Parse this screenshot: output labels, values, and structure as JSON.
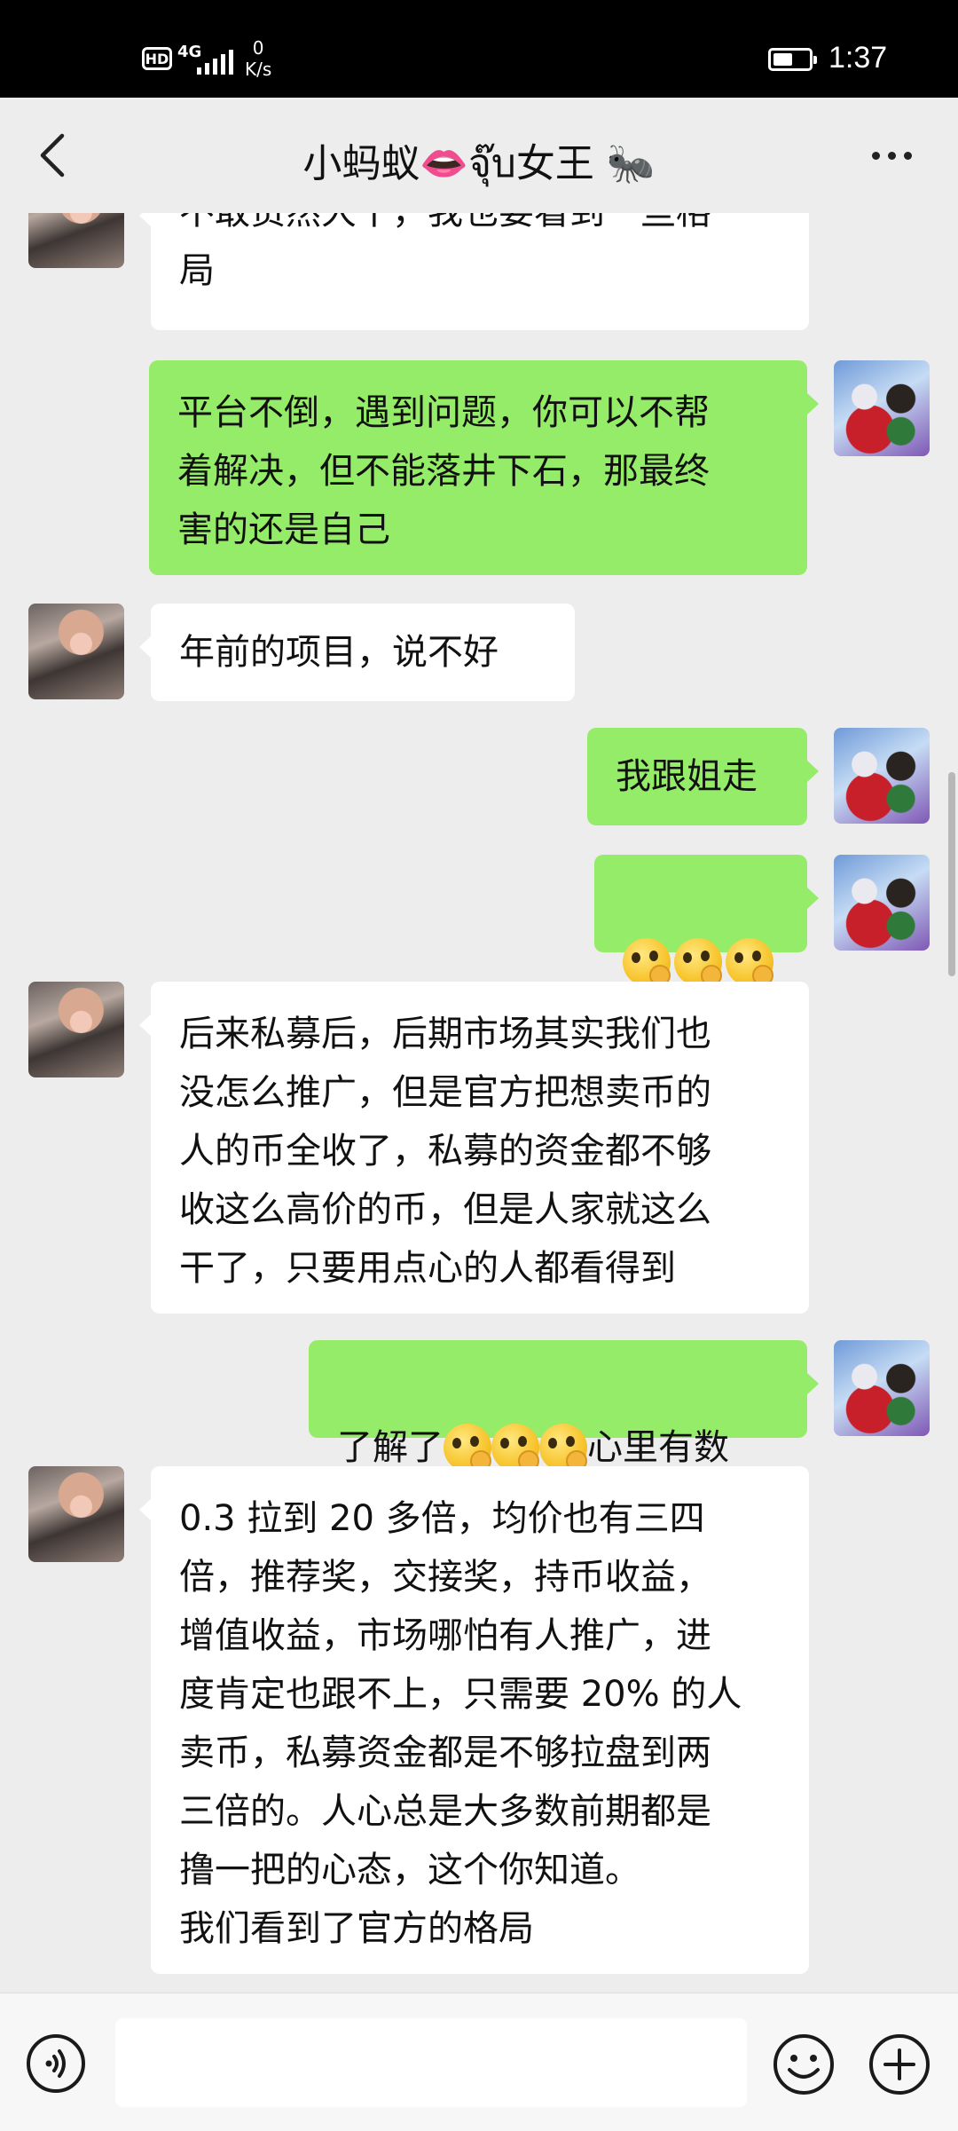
{
  "status_bar": {
    "hd": "HD",
    "network": "4G",
    "speed_value": "0",
    "speed_unit": "K/s",
    "time": "1:37",
    "battery_level": 0.55
  },
  "header": {
    "title": "小蚂蚁👄จุ๊บ女王 🐜",
    "back_icon": "chevron-left-icon",
    "more_icon": "more-dots-icon"
  },
  "messages": [
    {
      "side": "left",
      "text": "不敢贸然大干，我也要看到一些格\n局"
    },
    {
      "side": "right",
      "text": "平台不倒，遇到问题，你可以不帮\n着解决，但不能落井下石，那最终\n害的还是自己"
    },
    {
      "side": "left",
      "text": "年前的项目，说不好"
    },
    {
      "side": "right",
      "text": "我跟姐走"
    },
    {
      "side": "right",
      "emoji": [
        "salute-emoji",
        "salute-emoji",
        "salute-emoji"
      ]
    },
    {
      "side": "left",
      "text": "后来私募后，后期市场其实我们也\n没怎么推广，但是官方把想卖币的\n人的币全收了，私募的资金都不够\n收这么高价的币，但是人家就这么\n干了，只要用点心的人都看得到"
    },
    {
      "side": "right",
      "text_before": "了解了",
      "emoji": [
        "salute-emoji",
        "salute-emoji",
        "salute-emoji"
      ],
      "text_after": "心里有数"
    },
    {
      "side": "left",
      "text": "0.3 拉到 20 多倍，均价也有三四\n倍，推荐奖，交接奖，持币收益，\n增值收益，市场哪怕有人推广，进\n度肯定也跟不上，只需要 20% 的人\n卖币，私募资金都是不够拉盘到两\n三倍的。人心总是大多数前期都是\n撸一把的心态，这个你知道。\n我们看到了官方的格局"
    }
  ],
  "input_bar": {
    "voice_icon": "voice-icon",
    "emoji_icon": "smiley-icon",
    "plus_icon": "plus-icon",
    "text_value": ""
  }
}
